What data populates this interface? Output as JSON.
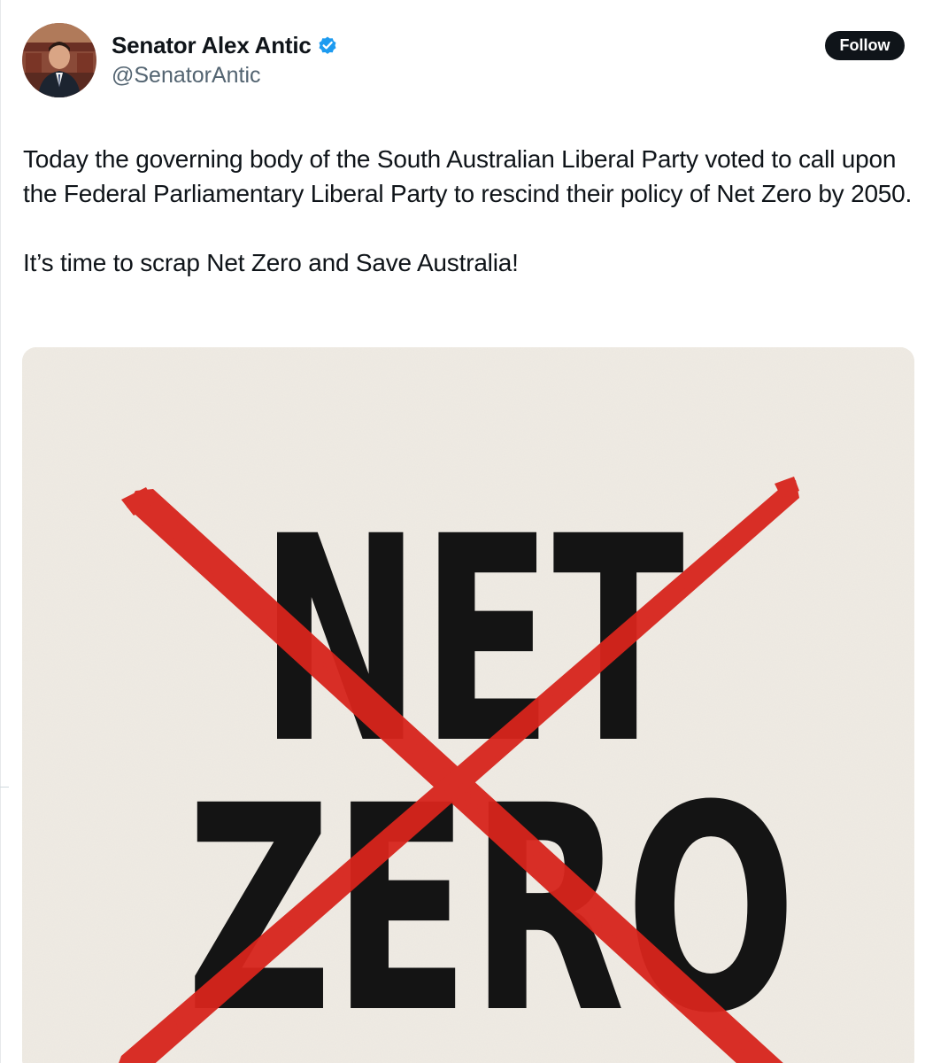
{
  "author": {
    "display_name": "Senator Alex Antic",
    "handle": "@SenatorAntic",
    "verified": true,
    "verified_color": "#1d9bf0"
  },
  "follow": {
    "label": "Follow"
  },
  "tweet": {
    "paragraphs": [
      "Today the governing body of the South Australian Liberal Party voted to call upon the Federal Parliamentary Liberal Party to rescind their policy of Net Zero by 2050.",
      "It’s time to scrap Net Zero and Save Australia!"
    ]
  },
  "media": {
    "line1": "NET",
    "line2": "ZERO",
    "background_color": "#efebe4",
    "text_color": "#141414",
    "cross_color": "#d7241c"
  }
}
